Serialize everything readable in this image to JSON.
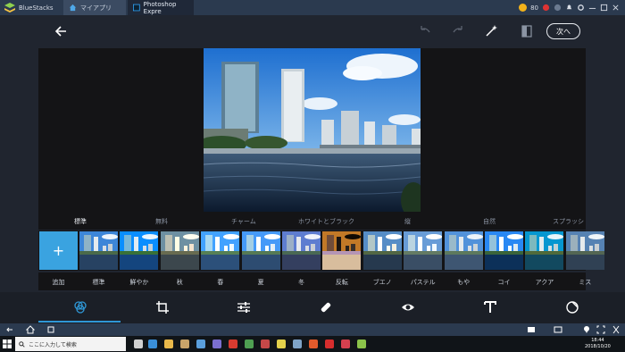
{
  "window": {
    "app_name": "BlueStacks",
    "tabs": [
      {
        "label": "マイアプリ"
      },
      {
        "label": "Photoshop Expre"
      }
    ],
    "coins": "80"
  },
  "header": {
    "next_label": "次へ"
  },
  "categories": [
    "標準",
    "無料",
    "チャーム",
    "ホワイトとブラック",
    "縦",
    "自然",
    "スプラッシ"
  ],
  "filters": {
    "add_label": "追加",
    "add_symbol": "+",
    "items": [
      "標準",
      "鮮やか",
      "秋",
      "春",
      "夏",
      "冬",
      "反転",
      "ブエノ",
      "パステル",
      "もや",
      "コイ",
      "アクア",
      "ミス"
    ]
  },
  "taskbar": {
    "search_placeholder": "ここに入力して検索",
    "time": "18:44",
    "date": "2018/10/20"
  },
  "colors": {
    "accent": "#2f97d6",
    "add_tile": "#3aa3e0"
  }
}
